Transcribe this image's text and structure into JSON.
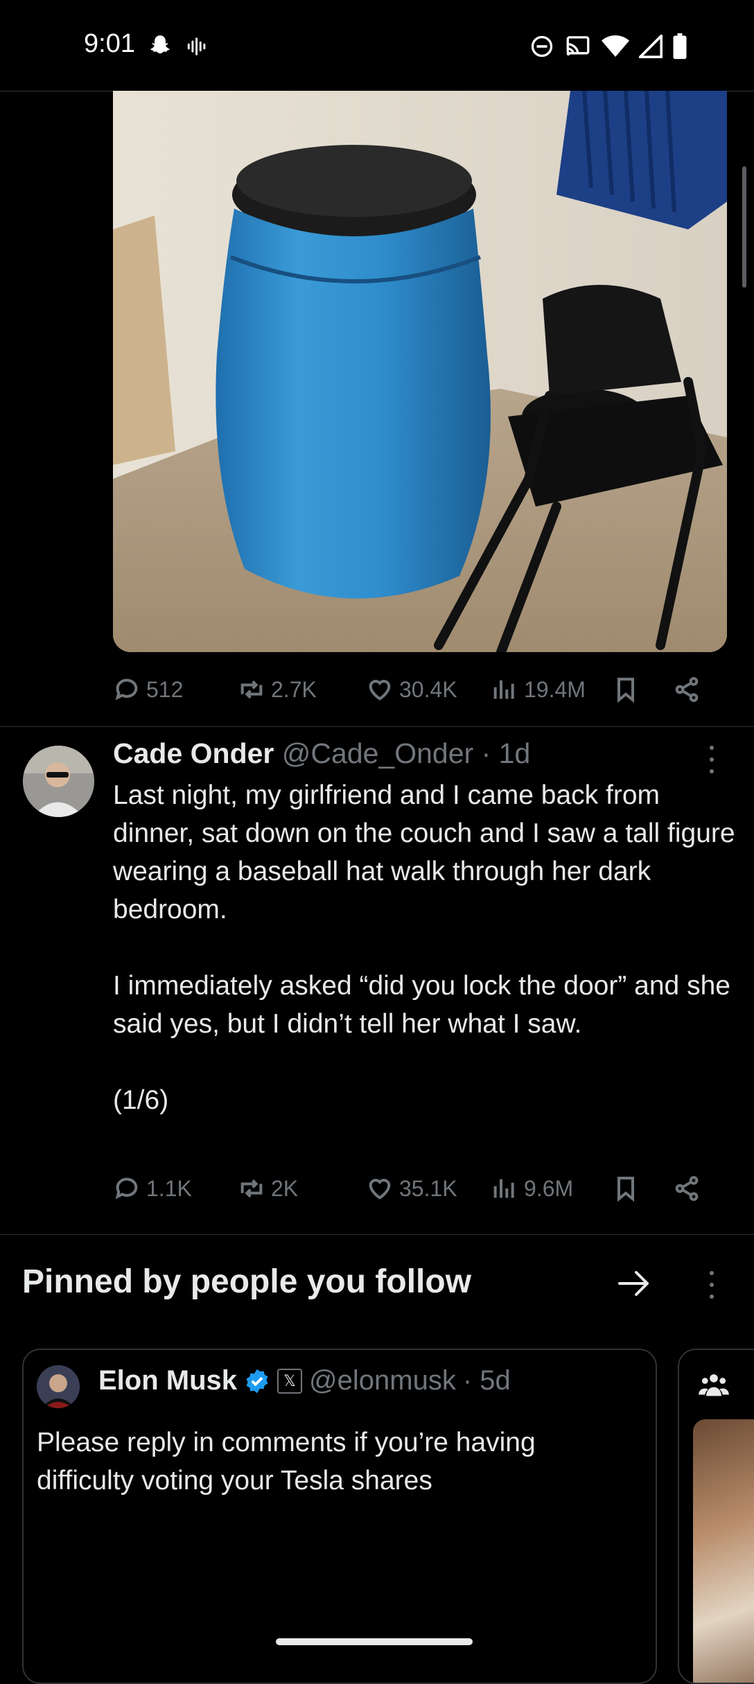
{
  "status_bar": {
    "time": "9:01"
  },
  "post1": {
    "actions": {
      "replies": "512",
      "reposts": "2.7K",
      "likes": "30.4K",
      "views": "19.4M"
    }
  },
  "tweet": {
    "name": "Cade Onder",
    "handle": "@Cade_Onder",
    "time": "· 1d",
    "body": "Last night, my girlfriend and I came back from dinner, sat down on the couch and I saw a tall figure wearing a baseball hat walk through her dark bedroom.\n\nI immediately asked “did you lock the door” and she said yes, but I didn’t tell her what I saw.\n\n(1/6)",
    "actions": {
      "replies": "1.1K",
      "reposts": "2K",
      "likes": "35.1K",
      "views": "9.6M"
    }
  },
  "pinned": {
    "title": "Pinned by people you follow",
    "card": {
      "name": "Elon Musk",
      "handle": "@elonmusk",
      "time": "· 5d",
      "body": "Please reply in comments if you’re having difficulty voting your Tesla shares"
    }
  },
  "colors": {
    "accent": "#1d9bf0",
    "muted": "#71767b",
    "text": "#e7e9ea",
    "border": "#2f3336"
  }
}
